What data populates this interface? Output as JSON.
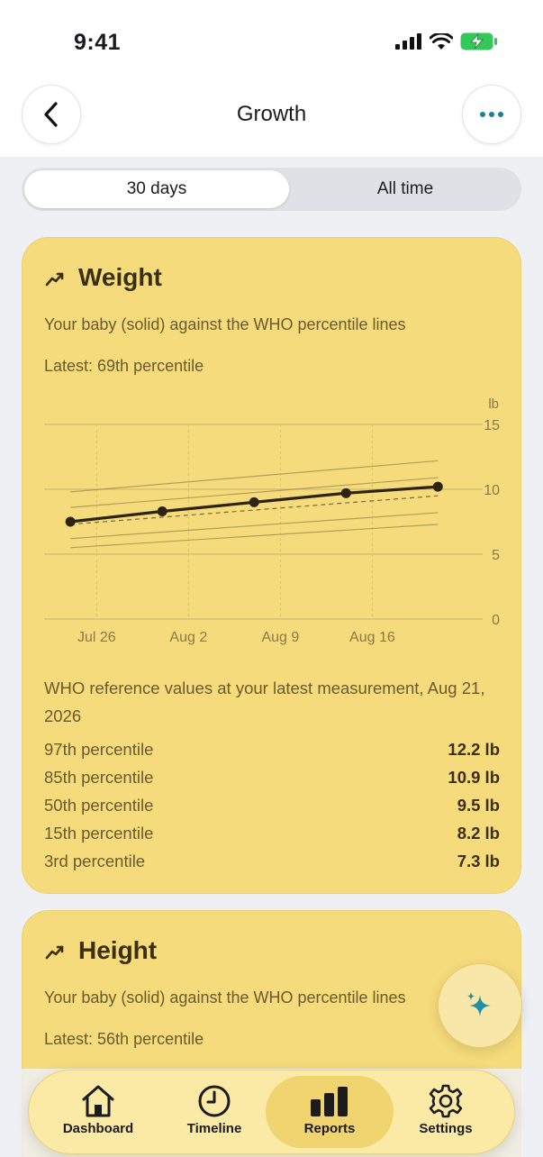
{
  "status_bar": {
    "time": "9:41"
  },
  "header": {
    "title": "Growth",
    "back_icon": "chevron-left-icon",
    "more_icon": "ellipsis-icon"
  },
  "range_toggle": {
    "options": [
      "30 days",
      "All time"
    ],
    "selected": "30 days"
  },
  "weight_card": {
    "title": "Weight",
    "icon": "trend-up-icon",
    "description": "Your baby (solid) against the WHO percentile lines",
    "latest": "Latest: 69th percentile",
    "chart_data": {
      "type": "line",
      "title": "",
      "xlabel": "",
      "ylabel": "lb",
      "ylim": [
        0,
        15
      ],
      "yticks": [
        "0",
        "5",
        "10",
        "15"
      ],
      "xticks": [
        "Jul 26",
        "Aug 2",
        "Aug 9",
        "Aug 16"
      ],
      "grid": true,
      "series": [
        {
          "name": "Your baby",
          "x": [
            "2026-07-24",
            "2026-07-31",
            "2026-08-07",
            "2026-08-14",
            "2026-08-21"
          ],
          "y": [
            7.5,
            8.3,
            9.0,
            9.7,
            10.2
          ]
        }
      ],
      "reference_lines": [
        {
          "x": [
            "2026-07-24",
            "2026-08-21"
          ],
          "y": [
            9.8,
            12.2
          ]
        },
        {
          "x": [
            "2026-07-24",
            "2026-08-21"
          ],
          "y": [
            8.6,
            10.9
          ]
        },
        {
          "x": [
            "2026-07-24",
            "2026-08-21"
          ],
          "y": [
            7.3,
            9.5
          ]
        },
        {
          "x": [
            "2026-07-24",
            "2026-08-21"
          ],
          "y": [
            6.2,
            8.2
          ]
        },
        {
          "x": [
            "2026-07-24",
            "2026-08-21"
          ],
          "y": [
            5.5,
            7.3
          ]
        }
      ]
    },
    "reference_heading": "WHO reference values at your latest measurement, Aug 21, 2026",
    "reference_rows": [
      {
        "label": "97th percentile",
        "value": "12.2 lb"
      },
      {
        "label": "85th percentile",
        "value": "10.9 lb"
      },
      {
        "label": "50th percentile",
        "value": "9.5 lb"
      },
      {
        "label": "15th percentile",
        "value": "8.2 lb"
      },
      {
        "label": "3rd percentile",
        "value": "7.3 lb"
      }
    ]
  },
  "height_card": {
    "title": "Height",
    "icon": "trend-up-icon",
    "description": "Your baby (solid) against the WHO percentile lines",
    "latest": "Latest: 56th percentile"
  },
  "fab": {
    "icon": "sparkles-icon"
  },
  "tab_bar": {
    "tabs": [
      {
        "label": "Dashboard",
        "icon": "home-icon"
      },
      {
        "label": "Timeline",
        "icon": "clock-icon"
      },
      {
        "label": "Reports",
        "icon": "bar-chart-icon"
      },
      {
        "label": "Settings",
        "icon": "gear-icon"
      }
    ],
    "selected": "Reports"
  },
  "colors": {
    "card": "#f5db7b",
    "tab_bar": "#faeaa6",
    "accent_blue": "#1a7f9c",
    "baby_line": "#2d2410"
  }
}
